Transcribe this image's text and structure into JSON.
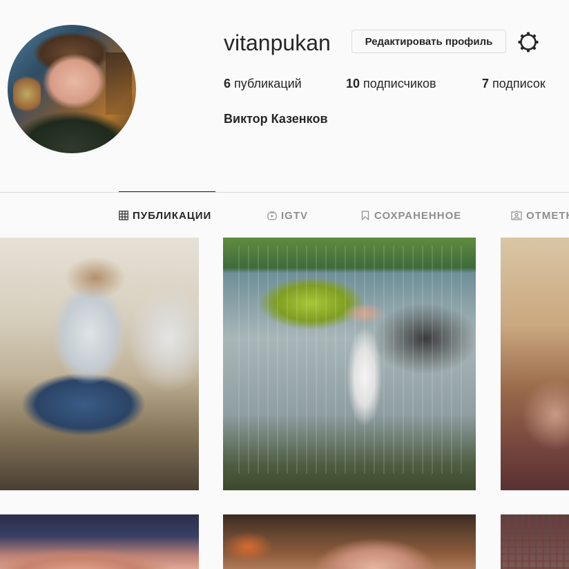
{
  "profile": {
    "username": "vitanpukan",
    "edit_button_label": "Редактировать профиль",
    "full_name": "Виктор Казенков"
  },
  "stats": {
    "posts": {
      "count": "6",
      "label": "публикаций"
    },
    "followers": {
      "count": "10",
      "label": "подписчиков"
    },
    "following": {
      "count": "7",
      "label": "подписок"
    }
  },
  "tabs": [
    {
      "label": "ПУБЛИКАЦИИ",
      "icon": "grid-icon",
      "active": true
    },
    {
      "label": "IGTV",
      "icon": "igtv-icon",
      "active": false
    },
    {
      "label": "СОХРАНЕННОЕ",
      "icon": "bookmark-icon",
      "active": false
    },
    {
      "label": "ОТМЕТКИ",
      "icon": "tagged-icon",
      "active": false
    }
  ],
  "colors": {
    "background": "#fafafa",
    "text": "#262626",
    "muted": "#8e8e8e",
    "border": "#dbdbdb"
  }
}
